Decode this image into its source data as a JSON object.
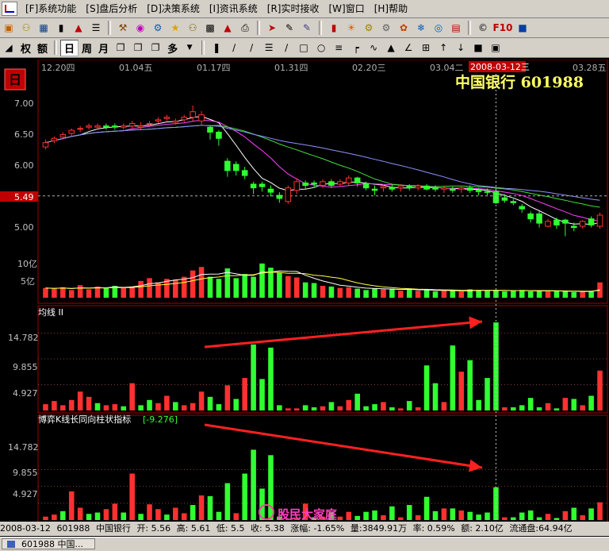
{
  "menu": {
    "items": [
      "[F]系统功能",
      "[S]盘后分析",
      "[D]决策系统",
      "[I]资讯系统",
      "[R]实时接收",
      "[W]窗口",
      "[H]帮助"
    ]
  },
  "toolbar": {
    "icons": [
      "open-icon",
      "calc-icon",
      "grid-icon",
      "bar-icon",
      "chart-icon",
      "list-icon",
      "tool-icon",
      "palette-icon",
      "network-icon",
      "star-icon",
      "wallet-icon",
      "table-icon",
      "chart2-icon",
      "printer-icon",
      "arrow-icon",
      "ruler-icon",
      "paint-icon",
      "stats-icon",
      "sun-icon",
      "gear-icon",
      "cog-icon",
      "flower-icon",
      "settings-icon",
      "globe-icon",
      "f10-icon",
      "page-icon"
    ],
    "f10_label": "F10",
    "rights_label": "权",
    "amount_label": "额",
    "periods": [
      "日",
      "周",
      "月"
    ],
    "more_label": "多"
  },
  "price_panel": {
    "badge": "日",
    "dates": [
      "12.20四",
      "01.04五",
      "01.17四",
      "01.31四",
      "02.20三",
      "03.04二",
      "03.28五"
    ],
    "cursor_date": "2008-03-12三",
    "stock_title": "中国银行  601988",
    "y_ticks": [
      "7.00",
      "6.50",
      "6.00",
      "5.00"
    ],
    "current_price": "5.49",
    "vol_ticks": [
      "10亿",
      "5亿"
    ]
  },
  "indicator1": {
    "title": "均线 II",
    "y_ticks": [
      "14.782",
      "9.855",
      "4.927"
    ]
  },
  "indicator2": {
    "title": "博弈K线长同向柱状指标",
    "value": "[-9.276]",
    "y_ticks": [
      "14.782",
      "9.855",
      "4.927"
    ]
  },
  "watermark": {
    "text": "股民大家庭"
  },
  "status": {
    "date": "2008-03-12",
    "code": "601988",
    "name": "中国银行",
    "open": "开: 5.56",
    "high": "高: 5.61",
    "low": "低: 5.5",
    "close": "收: 5.38",
    "change": "涨幅: -1.65%",
    "volume": "量:3849.91万",
    "turnover": "率: 0.59%",
    "amount": "额: 2.10亿",
    "float": "流通盘:64.94亿"
  },
  "taskbar": {
    "item": "601988 中国..."
  },
  "colors": {
    "up": "#ff3030",
    "down": "#30ff30",
    "ma1": "#ffffff",
    "ma2": "#ff40ff",
    "ma3": "#40e040",
    "ma4": "#9090ff",
    "axis": "#b00000",
    "title": "#ffff66"
  },
  "chart_data": {
    "type": "candlestick",
    "x": [
      "2007-12-20",
      "2007-12-21",
      "2007-12-24",
      "2007-12-25",
      "2007-12-26",
      "2007-12-27",
      "2007-12-28",
      "2008-01-02",
      "2008-01-03",
      "2008-01-04",
      "2008-01-07",
      "2008-01-08",
      "2008-01-09",
      "2008-01-10",
      "2008-01-11",
      "2008-01-14",
      "2008-01-15",
      "2008-01-16",
      "2008-01-17",
      "2008-01-18",
      "2008-01-21",
      "2008-01-22",
      "2008-01-23",
      "2008-01-24",
      "2008-01-25",
      "2008-01-28",
      "2008-01-29",
      "2008-01-30",
      "2008-01-31",
      "2008-02-01",
      "2008-02-04",
      "2008-02-05",
      "2008-02-13",
      "2008-02-14",
      "2008-02-15",
      "2008-02-18",
      "2008-02-19",
      "2008-02-20",
      "2008-02-21",
      "2008-02-22",
      "2008-02-25",
      "2008-02-26",
      "2008-02-27",
      "2008-02-28",
      "2008-02-29",
      "2008-03-03",
      "2008-03-04",
      "2008-03-05",
      "2008-03-06",
      "2008-03-07",
      "2008-03-10",
      "2008-03-11",
      "2008-03-12",
      "2008-03-13",
      "2008-03-14",
      "2008-03-17",
      "2008-03-18",
      "2008-03-19",
      "2008-03-20",
      "2008-03-21",
      "2008-03-24",
      "2008-03-25",
      "2008-03-26",
      "2008-03-27",
      "2008-03-28"
    ],
    "open": [
      6.28,
      6.38,
      6.44,
      6.5,
      6.57,
      6.6,
      6.6,
      6.62,
      6.62,
      6.6,
      6.62,
      6.6,
      6.65,
      6.7,
      6.74,
      6.68,
      6.72,
      6.76,
      6.7,
      6.6,
      6.52,
      6.05,
      6.0,
      5.9,
      5.68,
      5.68,
      5.6,
      5.5,
      5.4,
      5.58,
      5.7,
      5.7,
      5.66,
      5.72,
      5.68,
      5.7,
      5.78,
      5.68,
      5.6,
      5.62,
      5.63,
      5.62,
      5.65,
      5.62,
      5.65,
      5.62,
      5.6,
      5.6,
      5.6,
      5.62,
      5.58,
      5.56,
      5.56,
      5.46,
      5.4,
      5.32,
      5.2,
      5.2,
      5.0,
      5.1,
      5.1,
      5.0,
      5.0,
      5.12,
      5.0
    ],
    "close": [
      6.35,
      6.42,
      6.48,
      6.55,
      6.58,
      6.62,
      6.62,
      6.6,
      6.6,
      6.62,
      6.66,
      6.62,
      6.66,
      6.72,
      6.76,
      6.7,
      6.76,
      6.85,
      6.8,
      6.52,
      6.42,
      5.9,
      5.9,
      5.82,
      5.62,
      5.64,
      5.55,
      5.45,
      5.62,
      5.72,
      5.66,
      5.68,
      5.72,
      5.66,
      5.72,
      5.78,
      5.7,
      5.62,
      5.58,
      5.64,
      5.6,
      5.65,
      5.62,
      5.65,
      5.6,
      5.6,
      5.62,
      5.58,
      5.62,
      5.58,
      5.56,
      5.55,
      5.38,
      5.42,
      5.38,
      5.28,
      5.12,
      5.05,
      5.08,
      5.02,
      5.05,
      4.98,
      5.08,
      5.02,
      5.18
    ],
    "high": [
      6.4,
      6.45,
      6.52,
      6.58,
      6.62,
      6.66,
      6.66,
      6.66,
      6.66,
      6.66,
      6.7,
      6.68,
      6.7,
      6.76,
      6.8,
      6.74,
      6.8,
      6.95,
      6.86,
      6.62,
      6.55,
      6.1,
      6.05,
      5.96,
      5.72,
      5.72,
      5.66,
      5.55,
      5.66,
      5.78,
      5.74,
      5.74,
      5.76,
      5.76,
      5.76,
      5.82,
      5.8,
      5.72,
      5.66,
      5.68,
      5.67,
      5.68,
      5.68,
      5.68,
      5.68,
      5.66,
      5.66,
      5.64,
      5.66,
      5.66,
      5.62,
      5.61,
      5.61,
      5.52,
      5.44,
      5.36,
      5.24,
      5.24,
      5.12,
      5.14,
      5.12,
      5.06,
      5.1,
      5.16,
      5.22
    ],
    "low": [
      6.24,
      6.34,
      6.4,
      6.46,
      6.52,
      6.56,
      6.56,
      6.56,
      6.56,
      6.56,
      6.58,
      6.56,
      6.6,
      6.66,
      6.7,
      6.64,
      6.68,
      6.7,
      6.64,
      6.4,
      6.3,
      5.8,
      5.82,
      5.76,
      5.52,
      5.56,
      5.48,
      5.38,
      5.36,
      5.52,
      5.6,
      5.62,
      5.62,
      5.62,
      5.64,
      5.66,
      5.64,
      5.58,
      5.5,
      5.56,
      5.56,
      5.56,
      5.58,
      5.58,
      5.58,
      5.56,
      5.54,
      5.54,
      5.54,
      5.54,
      5.5,
      5.5,
      5.36,
      5.38,
      5.34,
      5.22,
      5.06,
      4.98,
      4.98,
      4.96,
      4.84,
      4.92,
      4.96,
      4.98,
      4.96
    ],
    "volume": [
      2.8,
      2.5,
      3.0,
      2.2,
      3.6,
      2.4,
      3.2,
      2.8,
      3.4,
      3.0,
      3.2,
      4.8,
      5.6,
      4.4,
      5.4,
      5.2,
      6.0,
      7.8,
      8.8,
      6.0,
      5.4,
      8.4,
      5.6,
      6.8,
      6.0,
      9.8,
      8.6,
      7.2,
      6.2,
      5.8,
      4.4,
      4.2,
      3.4,
      3.2,
      2.8,
      3.0,
      2.6,
      2.2,
      2.6,
      2.4,
      2.6,
      2.0,
      2.4,
      2.0,
      2.4,
      1.8,
      2.0,
      2.0,
      1.8,
      2.4,
      2.2,
      2.0,
      2.2,
      1.8,
      2.0,
      2.2,
      1.8,
      2.0,
      1.8,
      2.0,
      1.8,
      1.6,
      1.8,
      1.8,
      4.4
    ],
    "indicator1_values": [
      1.2,
      1.8,
      1.0,
      2.0,
      3.6,
      2.6,
      1.4,
      1.0,
      1.2,
      0.8,
      5.2,
      1.0,
      2.0,
      1.4,
      2.8,
      1.6,
      1.0,
      1.4,
      3.6,
      2.6,
      1.2,
      4.8,
      2.2,
      6.2,
      12.6,
      6.0,
      12.0,
      1.0,
      0.4,
      0.4,
      1.0,
      0.6,
      0.8,
      1.6,
      0.8,
      2.0,
      3.2,
      0.8,
      1.2,
      1.6,
      0.6,
      0.4,
      1.8,
      0.6,
      8.6,
      5.2,
      1.6,
      12.4,
      7.4,
      9.6,
      2.0,
      6.2,
      16.8,
      0.6,
      0.6,
      1.0,
      2.4,
      0.6,
      1.4,
      0.4,
      2.4,
      2.2,
      1.0,
      2.8,
      7.6
    ],
    "indicator1_up": [
      true,
      true,
      true,
      true,
      true,
      true,
      false,
      true,
      true,
      false,
      true,
      false,
      false,
      true,
      true,
      false,
      true,
      true,
      true,
      false,
      false,
      true,
      false,
      true,
      false,
      false,
      false,
      false,
      true,
      true,
      false,
      false,
      true,
      false,
      true,
      true,
      false,
      false,
      false,
      true,
      false,
      true,
      false,
      true,
      false,
      false,
      true,
      false,
      true,
      false,
      false,
      false,
      false,
      true,
      false,
      false,
      false,
      false,
      true,
      false,
      true,
      false,
      true,
      false,
      true
    ],
    "indicator2_values": [
      1.0,
      1.6,
      2.6,
      8.4,
      3.6,
      1.8,
      2.2,
      3.2,
      4.8,
      2.2,
      13.6,
      1.8,
      4.6,
      3.2,
      1.6,
      3.6,
      2.0,
      4.4,
      7.2,
      7.0,
      2.4,
      10.8,
      2.0,
      13.6,
      20.6,
      9.2,
      19.0,
      1.0,
      0.4,
      0.6,
      4.8,
      0.8,
      1.0,
      2.2,
      1.0,
      2.4,
      1.2,
      2.4,
      2.8,
      1.4,
      4.0,
      0.8,
      4.4,
      1.4,
      6.8,
      2.6,
      3.4,
      3.4,
      2.8,
      2.4,
      1.6,
      2.2,
      9.6,
      0.8,
      0.8,
      2.2,
      2.8,
      0.8,
      1.8,
      0.6,
      2.6,
      3.6,
      1.4,
      3.4,
      5.2
    ],
    "indicator2_up": [
      true,
      true,
      false,
      true,
      true,
      false,
      false,
      true,
      true,
      false,
      true,
      false,
      true,
      true,
      false,
      true,
      true,
      false,
      true,
      false,
      false,
      false,
      true,
      false,
      false,
      false,
      false,
      false,
      true,
      true,
      true,
      false,
      true,
      false,
      true,
      true,
      false,
      false,
      false,
      true,
      false,
      true,
      false,
      true,
      false,
      false,
      true,
      false,
      true,
      false,
      false,
      false,
      false,
      true,
      false,
      false,
      false,
      false,
      true,
      false,
      true,
      false,
      true,
      false,
      true
    ],
    "price_range": [
      4.8,
      7.1
    ],
    "y_ticks": [
      7.0,
      6.5,
      6.0,
      5.49,
      5.0
    ],
    "indicator_ticks": [
      14.782,
      9.855,
      4.927
    ]
  }
}
